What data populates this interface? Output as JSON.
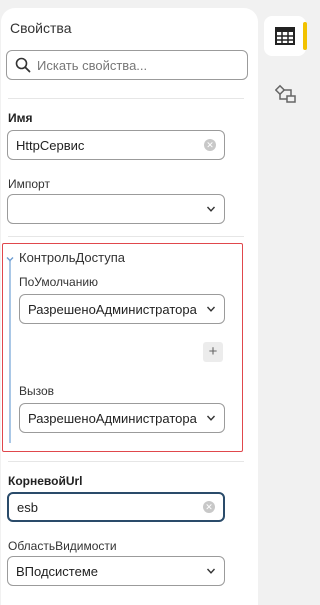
{
  "panel": {
    "title": "Свойства",
    "search": {
      "placeholder": "Искать свойства..."
    }
  },
  "fields": {
    "name": {
      "label": "Имя",
      "value": "HttpСервис"
    },
    "import": {
      "label": "Импорт",
      "value": ""
    },
    "access_group": {
      "title": "КонтрольДоступа",
      "default": {
        "label": "ПоУмолчанию",
        "value": "РазрешеноАдминистратора"
      },
      "call": {
        "label": "Вызов",
        "value": "РазрешеноАдминистратора"
      },
      "add_label": "+"
    },
    "root_url": {
      "label": "КорневойUrl",
      "value": "esb"
    },
    "visibility": {
      "label": "ОбластьВидимости",
      "value": "ВПодсистеме"
    }
  },
  "sidebar": {
    "tabs": [
      {
        "icon": "table-icon",
        "active": true
      },
      {
        "icon": "diagram-icon",
        "active": false
      }
    ],
    "accent_color": "#f2c200"
  },
  "colors": {
    "highlight_border": "#e0474c",
    "focus_border": "#2a4b6a"
  }
}
